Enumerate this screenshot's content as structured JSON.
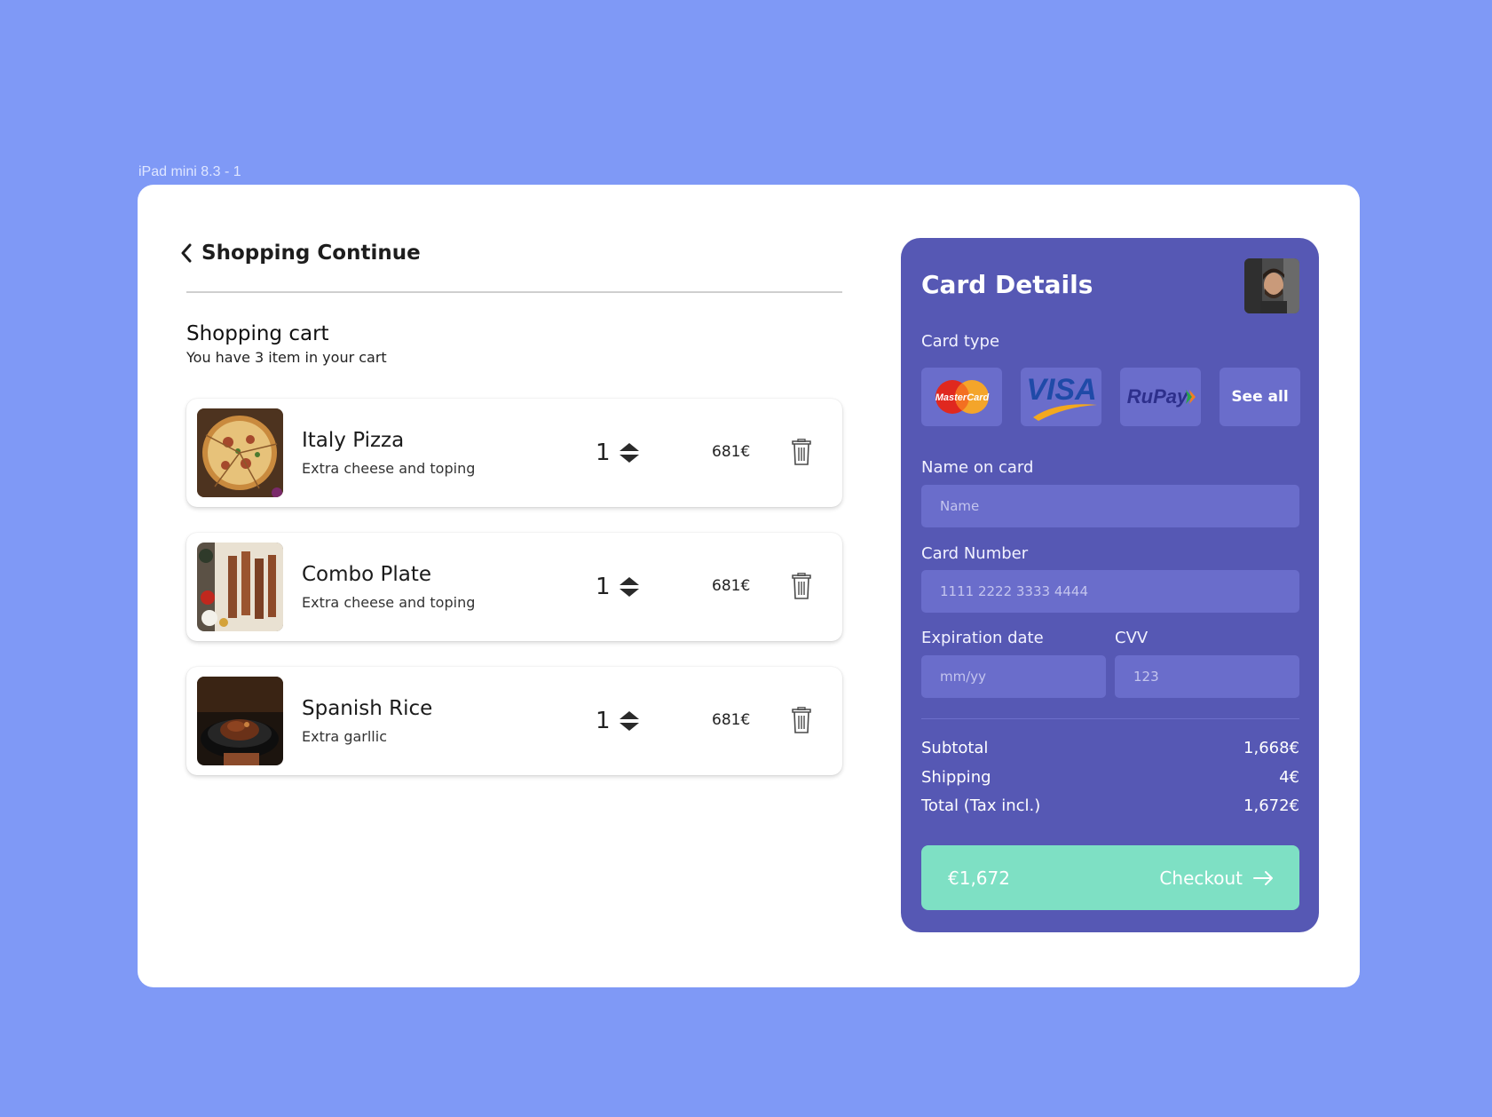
{
  "frame": {
    "label": "iPad mini 8.3 - 1"
  },
  "header": {
    "back_label": "Shopping Continue"
  },
  "cart": {
    "title": "Shopping cart",
    "subtitle": "You have 3 item in your cart",
    "items": [
      {
        "name": "Italy Pizza",
        "desc": "Extra cheese and toping",
        "qty": "1",
        "price": "681€"
      },
      {
        "name": "Combo Plate",
        "desc": "Extra cheese and toping",
        "qty": "1",
        "price": "681€"
      },
      {
        "name": "Spanish Rice",
        "desc": "Extra garllic",
        "qty": "1",
        "price": "681€"
      }
    ]
  },
  "card": {
    "title": "Card Details",
    "card_type_label": "Card type",
    "card_types": [
      {
        "brand": "MasterCard",
        "icon": "mastercard-logo"
      },
      {
        "brand": "VISA",
        "icon": "visa-logo"
      },
      {
        "brand": "RuPay",
        "icon": "rupay-logo"
      }
    ],
    "see_all": "See all",
    "name_label": "Name on card",
    "name_placeholder": "Name",
    "number_label": "Card Number",
    "number_placeholder": "1111 2222 3333 4444",
    "expiry_label": "Expiration date",
    "expiry_placeholder": "mm/yy",
    "cvv_label": "CVV",
    "cvv_placeholder": "123"
  },
  "summary": {
    "subtotal_label": "Subtotal",
    "subtotal": "1,668€",
    "shipping_label": "Shipping",
    "shipping": "4€",
    "total_label": "Total (Tax incl.)",
    "total": "1,672€"
  },
  "checkout": {
    "amount": "€1,672",
    "label": "Checkout"
  },
  "colors": {
    "background": "#7f99f6",
    "panel": "#5658b4",
    "input": "#6a6dcb",
    "checkout": "#7ee0c4"
  }
}
